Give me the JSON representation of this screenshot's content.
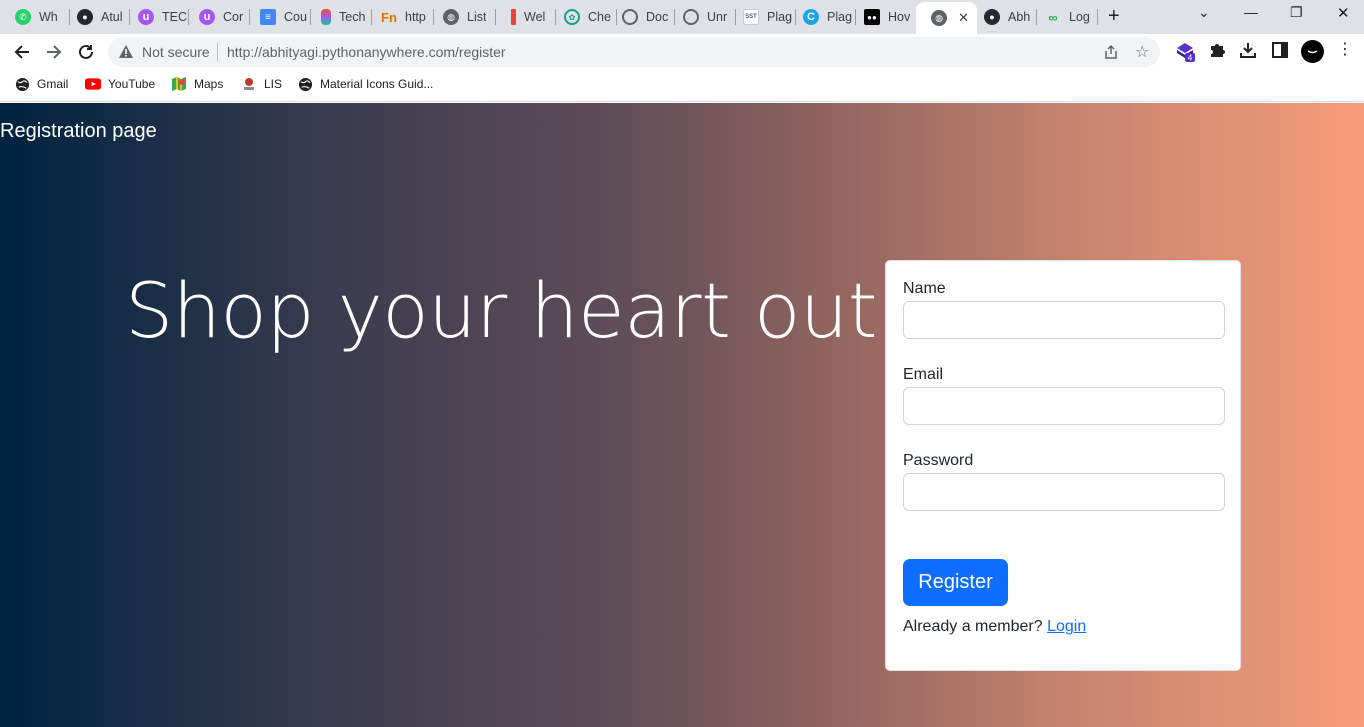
{
  "browser": {
    "tabs": [
      {
        "title": "Wh",
        "icon": "whatsapp-icon",
        "color": "#25d366"
      },
      {
        "title": "Atul",
        "icon": "github-icon",
        "color": "#24292f"
      },
      {
        "title": "TEC",
        "icon": "unstop-icon",
        "color": "#a855f7"
      },
      {
        "title": "Cor",
        "icon": "unstop-icon",
        "color": "#a855f7"
      },
      {
        "title": "Cou",
        "icon": "google-docs-icon",
        "color": "#4285f4"
      },
      {
        "title": "Tech",
        "icon": "figma-icon",
        "color": "#f24e1e"
      },
      {
        "title": "http",
        "icon": "fn-icon",
        "color": "#e37400"
      },
      {
        "title": "List",
        "icon": "globe-icon",
        "color": "#5f6368"
      },
      {
        "title": "Wel",
        "icon": "red-bar-icon",
        "color": "#ea4335"
      },
      {
        "title": "Che",
        "icon": "chatgpt-icon",
        "color": "#10a37f"
      },
      {
        "title": "Doc",
        "icon": "search-icon",
        "color": "#5f6368"
      },
      {
        "title": "Unr",
        "icon": "search-icon",
        "color": "#5f6368"
      },
      {
        "title": "Plag",
        "icon": "sst-icon",
        "color": "#5f6368"
      },
      {
        "title": "Plag",
        "icon": "c-icon",
        "color": "#1aa3e8"
      },
      {
        "title": "Hov",
        "icon": "medium-icon",
        "color": "#000000"
      },
      {
        "title": "",
        "icon": "globe-icon",
        "color": "#5f6368",
        "active": true
      },
      {
        "title": "Abh",
        "icon": "github-icon",
        "color": "#24292f"
      },
      {
        "title": "Log",
        "icon": "infinity-icon",
        "color": "#34a853"
      }
    ],
    "not_secure_label": "Not secure",
    "url": "http://abhityagi.pythonanywhere.com/register",
    "extension_badge": "4",
    "bookmarks": [
      {
        "label": "Gmail",
        "icon": "globe-icon"
      },
      {
        "label": "YouTube",
        "icon": "youtube-icon"
      },
      {
        "label": "Maps",
        "icon": "maps-icon"
      },
      {
        "label": "LIS",
        "icon": "lis-icon"
      },
      {
        "label": "Material Icons Guid...",
        "icon": "globe-icon"
      }
    ]
  },
  "page": {
    "title": "Registration page",
    "hero_text": "Shop your heart out",
    "form": {
      "name_label": "Name",
      "name_value": "",
      "email_label": "Email",
      "email_value": "",
      "password_label": "Password",
      "password_value": "",
      "register_button": "Register",
      "member_text": "Already a member?",
      "login_link": "Login"
    }
  },
  "colors": {
    "gradient_left": "#00233f",
    "gradient_right": "#f59d7a",
    "primary": "#0d6efd"
  }
}
